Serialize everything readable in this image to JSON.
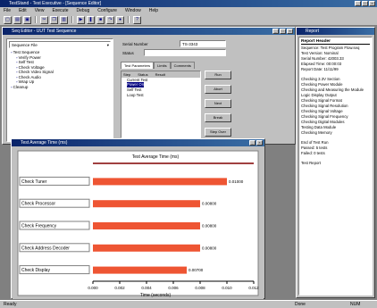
{
  "app": {
    "title": "TestStand - Test Executive - [Sequence Editor]",
    "menu": [
      "File",
      "Edit",
      "View",
      "Execute",
      "Debug",
      "Configure",
      "Window",
      "Help"
    ]
  },
  "toolbar": {
    "icons": [
      "new-icon",
      "open-icon",
      "save-icon",
      "cut-icon",
      "copy-icon",
      "paste-icon",
      "run-icon",
      "pause-icon",
      "stop-icon",
      "step-icon",
      "breakpoint-icon",
      "help-icon"
    ]
  },
  "workspace": {
    "title": "Seq Editor - UUT Test Sequence",
    "dropdown": "Sequence File",
    "tree": [
      "Test Sequence",
      "Verify Power",
      "Self Test",
      "Check Voltage",
      "Check Video Signal",
      "Check Audio",
      "Wrap Up",
      "Cleanup"
    ]
  },
  "properties": {
    "serial_label": "Serial Number",
    "serial_value": "TS-3343",
    "status_label": "Status",
    "tabs": [
      "Test Parameters",
      "Limits",
      "Comments"
    ],
    "list_header": [
      "Step",
      "Status",
      "Result"
    ],
    "list_items": [
      "Current Test",
      "Power On",
      "Self Test",
      "Loop Test"
    ],
    "buttons": [
      "Run",
      "Abort",
      "Next",
      "Break",
      "Step Over"
    ]
  },
  "report": {
    "title": "Report",
    "header": "Report Header",
    "lines": [
      "Sequence: Test Program Flow.seq",
      "Test Version: Nominal",
      "Serial Number: 42003.33",
      "Elapsed Time: 00:00:03",
      "Report Date: 11/11/99",
      "",
      "Checking 3.3V Section",
      "Checking Power Module",
      "Checking and Measuring the Module",
      "Logic Display Output",
      "Checking Signal Format",
      "Checking Signal Resolution",
      "Checking Signal Voltage",
      "Checking Signal Frequency",
      "Checking Digital Modules",
      "Testing Data Module",
      "Checking Memory",
      "",
      "End of Test Run",
      "Passed: 5 tests",
      "Failed: 0 tests",
      "",
      "Test Report"
    ]
  },
  "chart_window": {
    "title": "Test Average Time (ms)",
    "chart_data": {
      "type": "bar",
      "title": "Test Average Time (ms)",
      "orientation": "horizontal",
      "categories": [
        "Check Tuner",
        "Check Processor",
        "Check Frequency",
        "Check Address Decoder",
        "Check Display"
      ],
      "values": [
        0.01,
        0.008,
        0.008,
        0.008,
        0.007
      ],
      "value_labels": [
        "0.01000",
        "0.00800",
        "0.00800",
        "0.00800",
        "0.00700"
      ],
      "xlabel": "Time (seconds)",
      "xticks": [
        "0.000",
        "0.002",
        "0.004",
        "0.006",
        "0.008",
        "0.010",
        "0.012"
      ],
      "xlim": [
        0,
        0.012
      ]
    }
  },
  "statusbar": {
    "left": "Ready",
    "middle": "Done",
    "right": "NUM"
  }
}
